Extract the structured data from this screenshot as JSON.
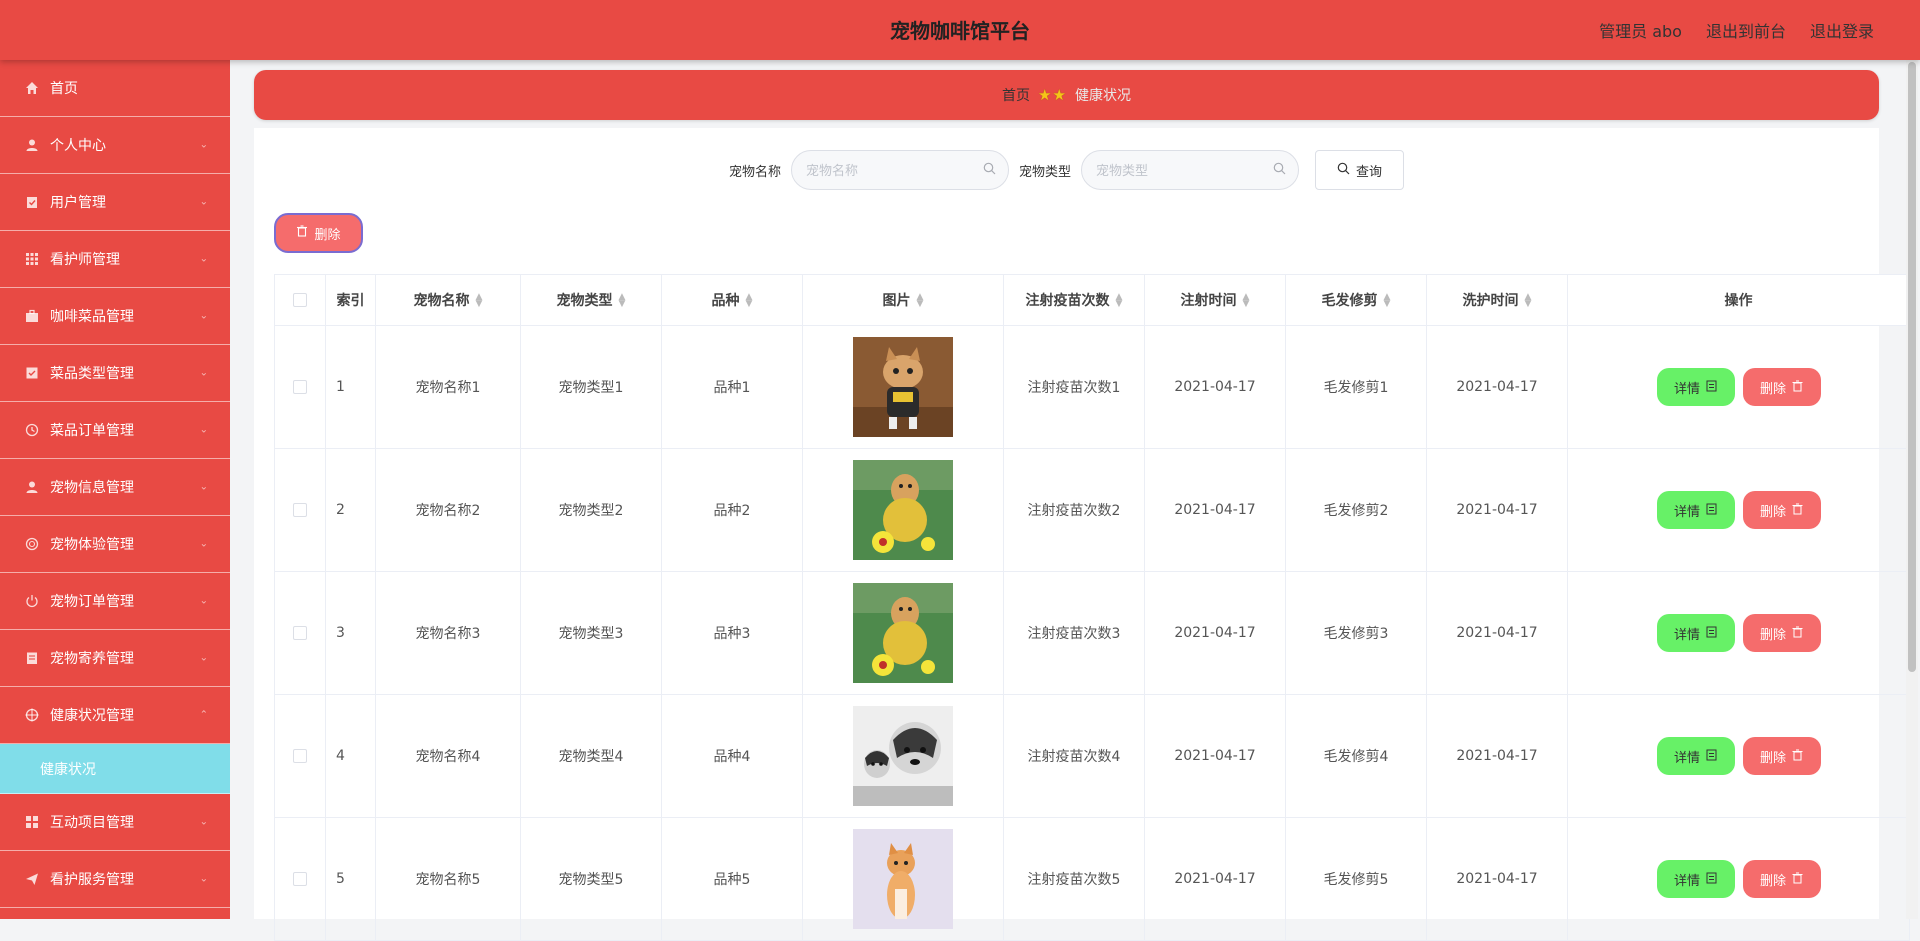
{
  "header": {
    "title": "宠物咖啡馆平台",
    "admin_label": "管理员 abo",
    "to_front": "退出到前台",
    "logout": "退出登录"
  },
  "sidebar": {
    "items": [
      {
        "label": "首页",
        "icon": "home-icon",
        "expandable": false
      },
      {
        "label": "个人中心",
        "icon": "user-icon",
        "expandable": true
      },
      {
        "label": "用户管理",
        "icon": "clipboard-icon",
        "expandable": true
      },
      {
        "label": "看护师管理",
        "icon": "grid-icon",
        "expandable": true
      },
      {
        "label": "咖啡菜品管理",
        "icon": "briefcase-icon",
        "expandable": true
      },
      {
        "label": "菜品类型管理",
        "icon": "checkbox-icon",
        "expandable": true
      },
      {
        "label": "菜品订单管理",
        "icon": "clock-icon",
        "expandable": true
      },
      {
        "label": "宠物信息管理",
        "icon": "person-icon",
        "expandable": true
      },
      {
        "label": "宠物体验管理",
        "icon": "globe-icon",
        "expandable": true
      },
      {
        "label": "宠物订单管理",
        "icon": "power-icon",
        "expandable": true
      },
      {
        "label": "宠物寄养管理",
        "icon": "doc-icon",
        "expandable": true
      },
      {
        "label": "健康状况管理",
        "icon": "target-icon",
        "expandable": true,
        "expanded": true
      }
    ],
    "submenu": {
      "label": "健康状况"
    },
    "items_after": [
      {
        "label": "互动项目管理",
        "icon": "grid-icon",
        "expandable": true
      },
      {
        "label": "看护服务管理",
        "icon": "send-icon",
        "expandable": true
      }
    ]
  },
  "breadcrumb": {
    "home": "首页",
    "current": "健康状况"
  },
  "search": {
    "name_label": "宠物名称",
    "name_placeholder": "宠物名称",
    "type_label": "宠物类型",
    "type_placeholder": "宠物类型",
    "query_button": "查询"
  },
  "toolbar": {
    "delete_label": "删除"
  },
  "table": {
    "columns": [
      "索引",
      "宠物名称",
      "宠物类型",
      "品种",
      "图片",
      "注射疫苗次数",
      "注射时间",
      "毛发修剪",
      "洗护时间",
      "操作"
    ],
    "detail_label": "详情",
    "delete_label": "删除",
    "rows": [
      {
        "index": "1",
        "name": "宠物名称1",
        "type": "宠物类型1",
        "breed": "品种1",
        "image": "cat-costume-photo",
        "vaccine": "注射疫苗次数1",
        "inject_time": "2021-04-17",
        "grooming": "毛发修剪1",
        "wash_time": "2021-04-17"
      },
      {
        "index": "2",
        "name": "宠物名称2",
        "type": "宠物类型2",
        "breed": "品种2",
        "image": "dog-soccer-photo",
        "vaccine": "注射疫苗次数2",
        "inject_time": "2021-04-17",
        "grooming": "毛发修剪2",
        "wash_time": "2021-04-17"
      },
      {
        "index": "3",
        "name": "宠物名称3",
        "type": "宠物类型3",
        "breed": "品种3",
        "image": "dog-soccer-photo",
        "vaccine": "注射疫苗次数3",
        "inject_time": "2021-04-17",
        "grooming": "毛发修剪3",
        "wash_time": "2021-04-17"
      },
      {
        "index": "4",
        "name": "宠物名称4",
        "type": "宠物类型4",
        "breed": "品种4",
        "image": "husky-puppy-photo",
        "vaccine": "注射疫苗次数4",
        "inject_time": "2021-04-17",
        "grooming": "毛发修剪4",
        "wash_time": "2021-04-17"
      },
      {
        "index": "5",
        "name": "宠物名称5",
        "type": "宠物类型5",
        "breed": "品种5",
        "image": "orange-cat-photo",
        "vaccine": "注射疫苗次数5",
        "inject_time": "2021-04-17",
        "grooming": "毛发修剪5",
        "wash_time": "2021-04-17"
      }
    ]
  },
  "colors": {
    "primary": "#e84a44",
    "submenu_active": "#80dde9",
    "detail_button": "#67f167",
    "delete_button": "#f56c6c"
  }
}
